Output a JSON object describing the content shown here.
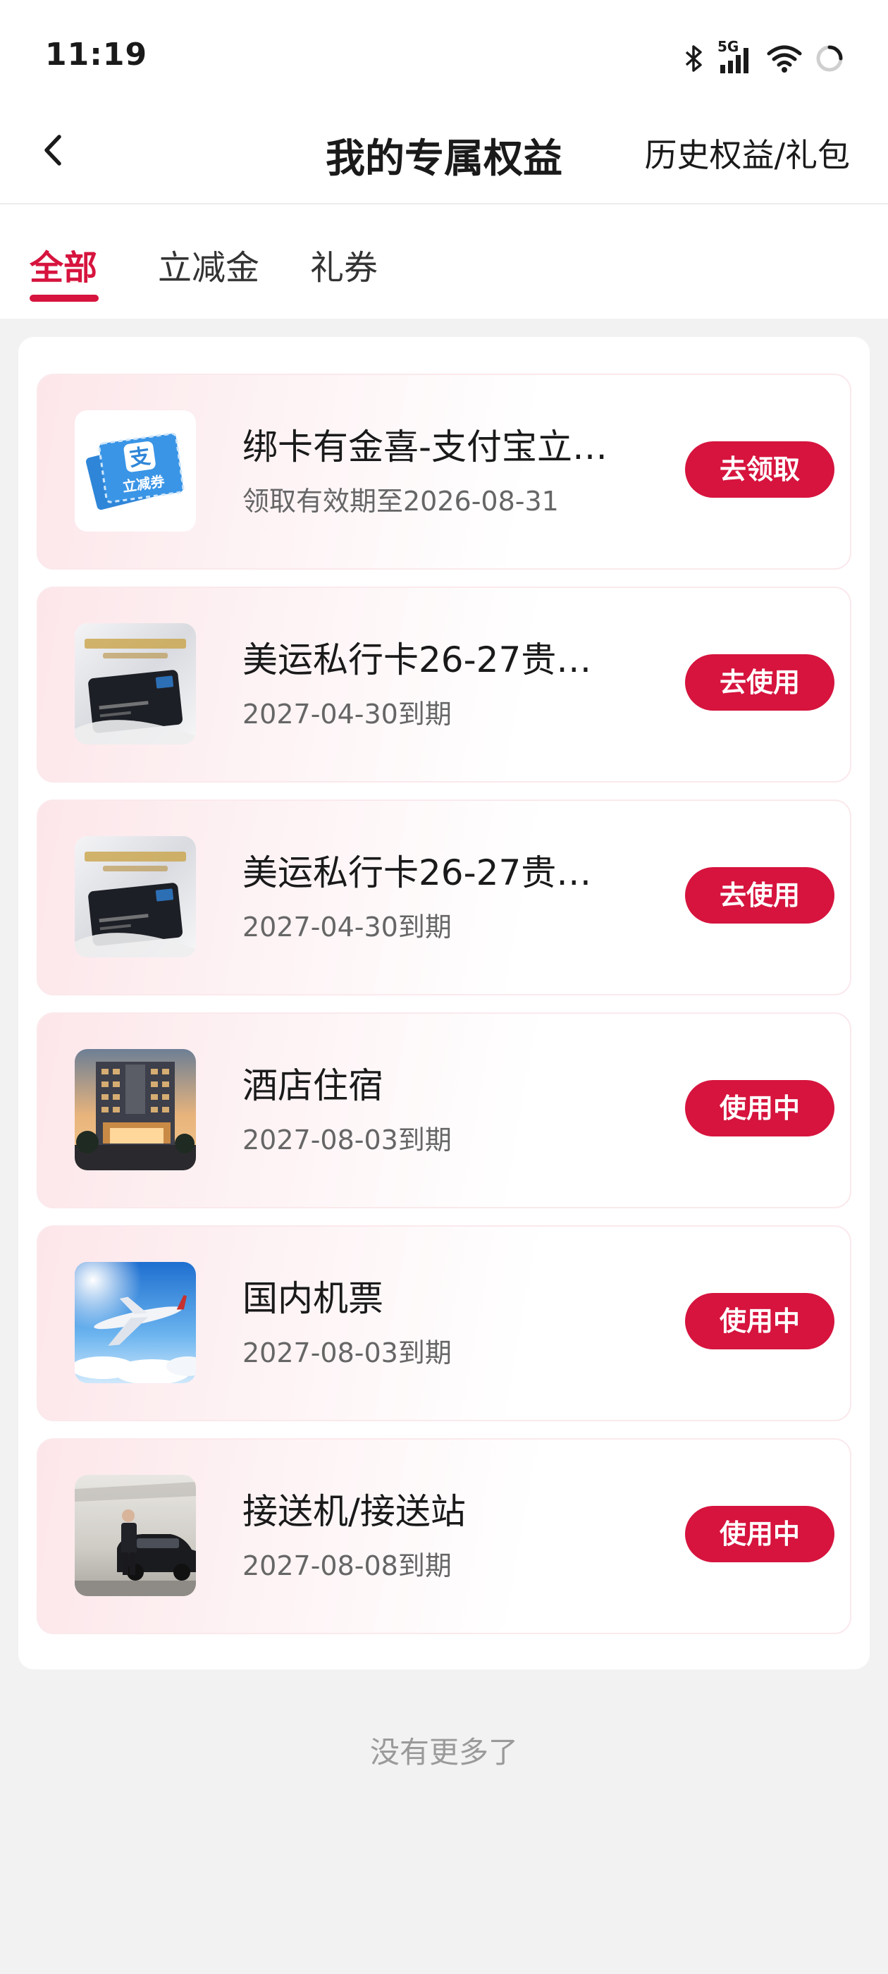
{
  "status_bar": {
    "time": "11:19",
    "network": "5G"
  },
  "header": {
    "title": "我的专属权益",
    "history_link": "历史权益/礼包"
  },
  "tabs": [
    {
      "label": "全部",
      "active": true
    },
    {
      "label": "立减金",
      "active": false
    },
    {
      "label": "礼券",
      "active": false
    }
  ],
  "items": [
    {
      "title": "绑卡有金喜-支付宝立…",
      "subtitle": "领取有效期至2026-08-31",
      "button": "去领取",
      "thumb_icon": "alipay-coupon-icon",
      "thumb_caption": "立减券",
      "thumb_mark": "支"
    },
    {
      "title": "美运私行卡26-27贵…",
      "subtitle": "2027-04-30到期",
      "button": "去使用",
      "thumb_icon": "private-bank-card-image"
    },
    {
      "title": "美运私行卡26-27贵…",
      "subtitle": "2027-04-30到期",
      "button": "去使用",
      "thumb_icon": "private-bank-card-image"
    },
    {
      "title": "酒店住宿",
      "subtitle": "2027-08-03到期",
      "button": "使用中",
      "thumb_icon": "hotel-image"
    },
    {
      "title": "国内机票",
      "subtitle": "2027-08-03到期",
      "button": "使用中",
      "thumb_icon": "airplane-image"
    },
    {
      "title": "接送机/接送站",
      "subtitle": "2027-08-08到期",
      "button": "使用中",
      "thumb_icon": "car-chauffeur-image"
    }
  ],
  "footer": {
    "no_more": "没有更多了"
  },
  "colors": {
    "accent": "#d6143e",
    "card_gradient_start": "#fde6ea",
    "background": "#f2f2f3"
  }
}
